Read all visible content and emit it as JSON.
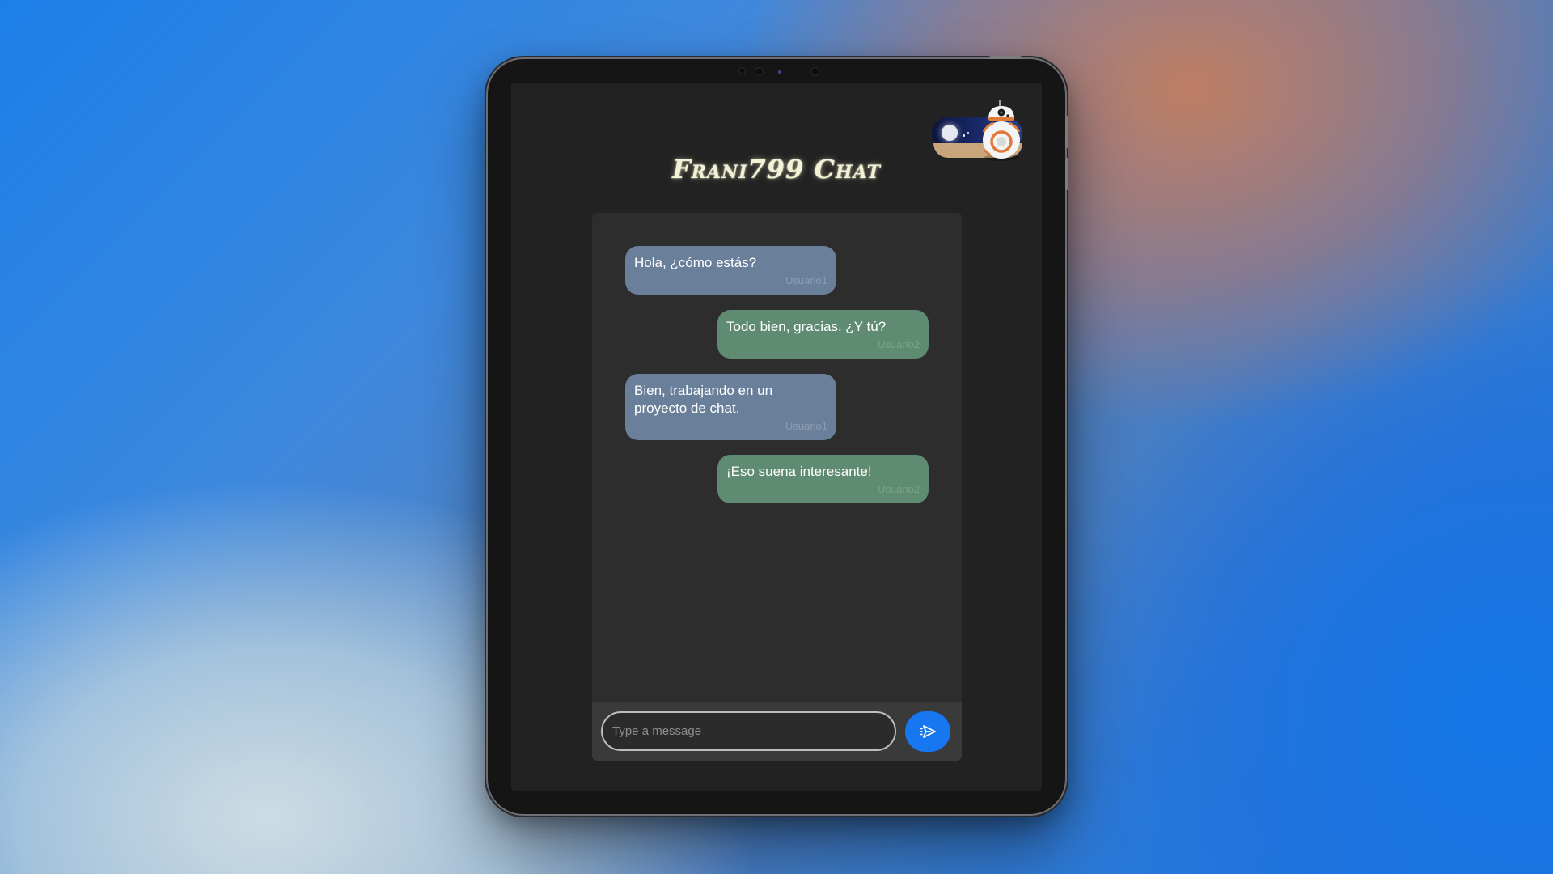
{
  "app": {
    "title": "Frani799 Chat"
  },
  "theme": {
    "accent": "#1677f0",
    "incoming_bubble": "#6a7f99",
    "outgoing_bubble": "#5f8b72",
    "background": "#222222"
  },
  "theme_toggle": {
    "icon": "bb8-night-toggle-icon",
    "state": "night"
  },
  "messages": [
    {
      "text": "Hola, ¿cómo estás?",
      "author": "Usuario1",
      "side": "incoming"
    },
    {
      "text": "Todo bien, gracias. ¿Y tú?",
      "author": "Usuario2",
      "side": "outgoing"
    },
    {
      "text": "Bien, trabajando en un proyecto de chat.",
      "author": "Usuario1",
      "side": "incoming"
    },
    {
      "text": "¡Eso suena interesante!",
      "author": "Usuario2",
      "side": "outgoing"
    }
  ],
  "composer": {
    "placeholder": "Type a message",
    "value": "",
    "send_icon": "send-icon"
  }
}
